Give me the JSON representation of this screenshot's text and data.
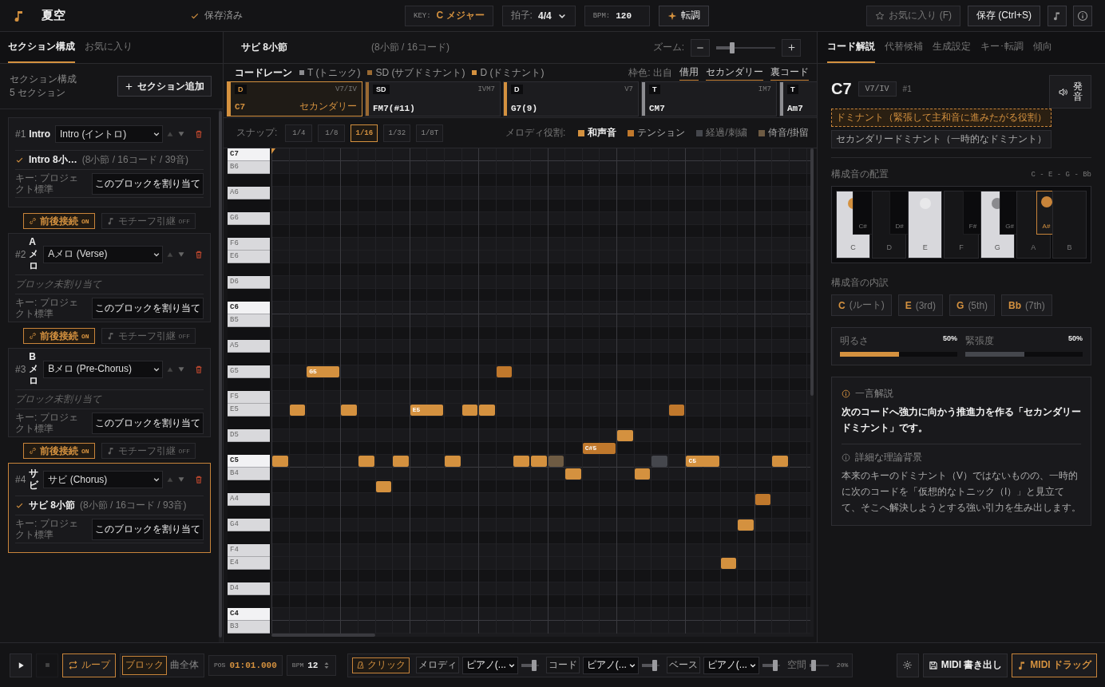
{
  "topbar": {
    "title": "夏空",
    "save_status": "保存済み",
    "key": {
      "label": "KEY:",
      "value": "C メジャー"
    },
    "time_signature": {
      "label": "拍子:",
      "value": "4/4"
    },
    "tempo": {
      "label": "BPM:",
      "value": "120"
    },
    "transpose_button": "転調",
    "favorite_button": {
      "label": "お気に入り (F)",
      "disabled": true
    },
    "save_button": "保存 (Ctrl+S)"
  },
  "sidebar": {
    "tabs": [
      {
        "label": "セクション構成",
        "selected": true
      },
      {
        "label": "お気に入り",
        "selected": false
      }
    ],
    "heading": "セクション構成",
    "count": "5 セクション",
    "add_button": "セクション追加",
    "sections": [
      {
        "number": "#1",
        "name": "Intro",
        "type": "Intro (イントロ)",
        "selected": false,
        "block": {
          "title": "Intro 8小…",
          "stats": "(8小節 / 16コード / 39音)"
        },
        "key": "キー: プロジェクト標準",
        "assign_button": "このブロックを割り当て"
      },
      {
        "number": "#2",
        "name": "Aメロ",
        "type": "Aメロ (Verse)",
        "selected": false,
        "empty_text": "ブロック未割り当て",
        "key": "キー: プロジェクト標準",
        "assign_button": "このブロックを割り当て"
      },
      {
        "number": "#3",
        "name": "Bメロ",
        "type": "Bメロ (Pre-Chorus)",
        "selected": false,
        "empty_text": "ブロック未割り当て",
        "key": "キー: プロジェクト標準",
        "assign_button": "このブロックを割り当て"
      },
      {
        "number": "#4",
        "name": "サビ",
        "type": "サビ (Chorus)",
        "selected": true,
        "block": {
          "title": "サビ 8小節",
          "stats": "(8小節 / 16コード / 93音)"
        },
        "key": "キー: プロジェクト標準",
        "assign_button": "このブロックを割り当て"
      }
    ],
    "links": [
      {
        "connect": {
          "label": "前後接続",
          "state": "ON",
          "on": true
        },
        "motif": {
          "label": "モチーフ引継",
          "state": "OFF",
          "on": false
        }
      },
      {
        "connect": {
          "label": "前後接続",
          "state": "ON",
          "on": true
        },
        "motif": {
          "label": "モチーフ引継",
          "state": "OFF",
          "on": false
        }
      },
      {
        "connect": {
          "label": "前後接続",
          "state": "ON",
          "on": true
        },
        "motif": {
          "label": "モチーフ引継",
          "state": "OFF",
          "on": false
        }
      }
    ]
  },
  "editor": {
    "title": "サビ 8小節",
    "summary": "(8小節 / 16コード)",
    "zoom": {
      "label": "ズーム:",
      "level": 0.27
    },
    "lane_title": "コードレーン",
    "functions": [
      {
        "label": "T (トニック)",
        "color": "#8c8c90"
      },
      {
        "label": "SD (サブドミナント)",
        "color": "#9a6a32"
      },
      {
        "label": "D (ドミナント)",
        "color": "#d4913f"
      }
    ],
    "origin_label": "枠色: 出自",
    "origins": [
      "借用",
      "セカンダリー",
      "裏コード"
    ],
    "chords": [
      {
        "function": "D",
        "color": "#d4913f",
        "degree": "V7/IV",
        "name": "C7",
        "tag": "セカンダリー",
        "selected": true
      },
      {
        "function": "SD",
        "color": "#9a6a32",
        "degree": "IVM7",
        "name": "FM7(#11)",
        "selected": false
      },
      {
        "function": "D",
        "color": "#d4913f",
        "degree": "V7",
        "name": "G7(9)",
        "selected": false
      },
      {
        "function": "T",
        "color": "#8c8c90",
        "degree": "IM7",
        "name": "CM7",
        "selected": false
      },
      {
        "function": "T",
        "color": "#8c8c90",
        "name": "Am7",
        "selected": false
      }
    ],
    "snap": {
      "label": "スナップ:",
      "options": [
        {
          "label": "1/4",
          "selected": false
        },
        {
          "label": "1/8",
          "selected": false
        },
        {
          "label": "1/16",
          "selected": true
        },
        {
          "label": "1/32",
          "selected": false
        },
        {
          "label": "1/8T",
          "selected": false
        }
      ]
    },
    "roles_label": "メロディ役割:",
    "roles": [
      {
        "label": "和声音",
        "color": "#d4913f"
      },
      {
        "label": "テンション",
        "color": "#c0782c"
      },
      {
        "label": "経過/刺繍",
        "color": "#45474d"
      },
      {
        "label": "倚音/掛留",
        "color": "#6e5b43"
      }
    ],
    "keys": [
      {
        "kind": "root",
        "label": "C7"
      },
      {
        "kind": "white",
        "label": "B6"
      },
      {
        "kind": "black"
      },
      {
        "kind": "white",
        "label": "A6"
      },
      {
        "kind": "black"
      },
      {
        "kind": "white",
        "label": "G6"
      },
      {
        "kind": "black"
      },
      {
        "kind": "white",
        "label": "F6"
      },
      {
        "kind": "white",
        "label": "E6"
      },
      {
        "kind": "black"
      },
      {
        "kind": "white",
        "label": "D6"
      },
      {
        "kind": "black"
      },
      {
        "kind": "root",
        "label": "C6"
      },
      {
        "kind": "white",
        "label": "B5"
      },
      {
        "kind": "black"
      },
      {
        "kind": "white",
        "label": "A5"
      },
      {
        "kind": "black"
      },
      {
        "kind": "white",
        "label": "G5"
      },
      {
        "kind": "black"
      },
      {
        "kind": "white",
        "label": "F5"
      },
      {
        "kind": "white",
        "label": "E5"
      },
      {
        "kind": "black"
      },
      {
        "kind": "white",
        "label": "D5"
      },
      {
        "kind": "black"
      },
      {
        "kind": "root",
        "label": "C5"
      },
      {
        "kind": "white",
        "label": "B4"
      },
      {
        "kind": "black"
      },
      {
        "kind": "white",
        "label": "A4"
      },
      {
        "kind": "black"
      },
      {
        "kind": "white",
        "label": "G4"
      },
      {
        "kind": "black"
      },
      {
        "kind": "white",
        "label": "F4"
      },
      {
        "kind": "white",
        "label": "E4"
      },
      {
        "kind": "black"
      },
      {
        "kind": "white",
        "label": "D4"
      },
      {
        "kind": "black"
      },
      {
        "kind": "root",
        "label": "C4"
      },
      {
        "kind": "white",
        "label": "B3"
      }
    ],
    "note_labels": [
      "G5",
      "E5",
      "C#5",
      "C5"
    ]
  },
  "inspector": {
    "tabs": [
      {
        "label": "コード解説",
        "selected": true
      },
      {
        "label": "代替候補",
        "selected": false
      },
      {
        "label": "生成設定",
        "selected": false
      },
      {
        "label": "キー･転調",
        "selected": false
      },
      {
        "label": "傾向",
        "selected": false
      }
    ],
    "chord": "C7",
    "degree": "V7/IV",
    "index": "#1",
    "play_button": "発音",
    "function_tag": "ドミナント（緊張して主和音に進みたがる役割）",
    "origin_tag": "セカンダリードミナント（一時的なドミナント）",
    "voicing_title": "構成音の配置",
    "voicing_notes": "C - E - G - Bb",
    "keyboard": [
      {
        "label": "C",
        "kind": "white",
        "on": true,
        "color": "#d4913f"
      },
      {
        "label": "C#",
        "kind": "black",
        "on": false
      },
      {
        "label": "D",
        "kind": "white",
        "on": false
      },
      {
        "label": "D#",
        "kind": "black",
        "on": false
      },
      {
        "label": "E",
        "kind": "white",
        "on": true,
        "color": "#e8e8ea"
      },
      {
        "label": "F",
        "kind": "white",
        "on": false
      },
      {
        "label": "F#",
        "kind": "black",
        "on": false
      },
      {
        "label": "G",
        "kind": "white",
        "on": true,
        "color": "#8a8a8e"
      },
      {
        "label": "G#",
        "kind": "black",
        "on": false
      },
      {
        "label": "A",
        "kind": "white",
        "on": false
      },
      {
        "label": "A#",
        "kind": "black",
        "on": true,
        "color": "#c8843a"
      },
      {
        "label": "B",
        "kind": "white",
        "on": false
      }
    ],
    "tones_title": "構成音の内訳",
    "tones": [
      {
        "note": "C",
        "role": "(ルート)"
      },
      {
        "note": "E",
        "role": "(3rd)"
      },
      {
        "note": "G",
        "role": "(5th)"
      },
      {
        "note": "Bb",
        "role": "(7th)"
      }
    ],
    "meters": [
      {
        "label": "明るさ",
        "reading": "50%",
        "level": 0.5,
        "color": "#d4913f"
      },
      {
        "label": "緊張度",
        "reading": "50%",
        "level": 0.5,
        "color": "#45474d"
      }
    ],
    "summary": {
      "title": "一言解説",
      "text": "次のコードへ強力に向かう推進力を作る「セカンダリードミナント」です。"
    },
    "detail": {
      "title": "詳細な理論背景",
      "text": "本来のキーのドミナント（V）ではないものの、一時的に次のコードを「仮想的なトニック（I）」と見立てて、そこへ解決しようとする強い引力を生み出します。"
    }
  },
  "transport": {
    "loop": {
      "label": "ループ",
      "on": true
    },
    "range": [
      {
        "label": "ブロック",
        "selected": true
      },
      {
        "label": "曲全体",
        "selected": false
      }
    ],
    "position": {
      "label": "POS",
      "value": "01:01.000"
    },
    "tempo": {
      "label": "BPM",
      "value": "12"
    },
    "click": {
      "label": "クリック",
      "on": true
    },
    "tracks": [
      {
        "label": "メロディ",
        "instrument": "ピアノ(...",
        "level": 0.75
      },
      {
        "label": "コード",
        "instrument": "ピアノ(...",
        "level": 0.75
      },
      {
        "label": "ベース",
        "instrument": "ピアノ(...",
        "level": 0.75
      }
    ],
    "reverb": {
      "label": "空間",
      "reading": "20%",
      "level": 0.2
    },
    "export_button": "MIDI 書き出し",
    "drag_button": "MIDI ドラッグ"
  }
}
